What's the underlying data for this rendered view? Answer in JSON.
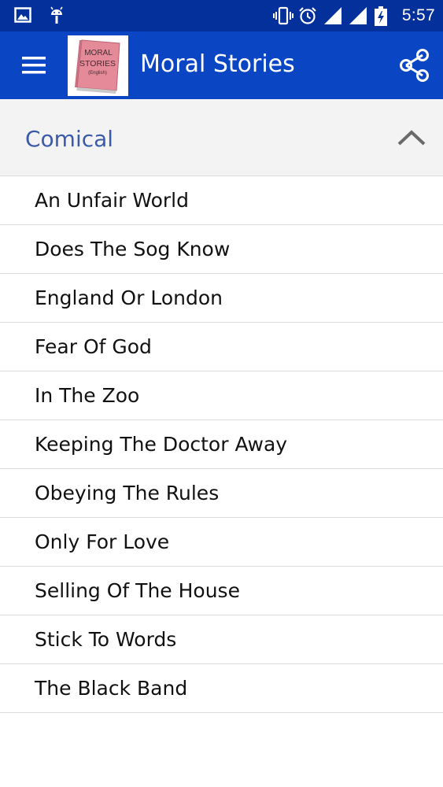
{
  "status_bar": {
    "time": "5:57",
    "left_icons": [
      "image-icon",
      "android-icon"
    ],
    "right_icons": [
      "vibrate-icon",
      "alarm-icon",
      "signal-icon",
      "signal-icon",
      "battery-charging-icon"
    ]
  },
  "app_bar": {
    "title": "Moral Stories",
    "logo_lines": [
      "MORAL",
      "STORIES",
      "(English)"
    ],
    "menu_icon": "hamburger-menu-icon",
    "share_icon": "share-icon"
  },
  "section": {
    "title": "Comical",
    "expand_icon": "chevron-up-icon"
  },
  "stories": [
    {
      "label": "An Unfair World"
    },
    {
      "label": "Does The Sog Know"
    },
    {
      "label": "England Or London"
    },
    {
      "label": "Fear Of God"
    },
    {
      "label": "In The Zoo"
    },
    {
      "label": "Keeping The Doctor Away"
    },
    {
      "label": "Obeying The Rules"
    },
    {
      "label": "Only For Love"
    },
    {
      "label": "Selling Of The House"
    },
    {
      "label": "Stick To Words"
    },
    {
      "label": "The Black Band"
    }
  ],
  "colors": {
    "status_bar": "#03309a",
    "app_bar": "#0a45c4",
    "section_title": "#3b5aa8",
    "section_bg": "#f3f3f4",
    "logo_book": "#e48a99"
  }
}
